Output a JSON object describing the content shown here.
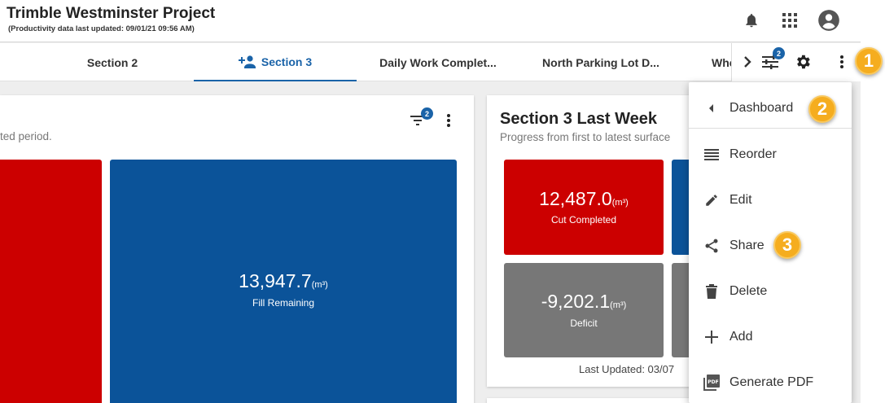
{
  "header": {
    "title": "Trimble Westminster Project",
    "subtitle": "(Productivity data last updated: 09/01/21 09:56 AM)",
    "icons": [
      "bell-icon",
      "apps-grid-icon",
      "account-icon"
    ]
  },
  "tabs": [
    {
      "label": "Section 2",
      "active": false
    },
    {
      "label": "Section 3",
      "active": true,
      "icon": "add-person-icon"
    },
    {
      "label": "Daily Work Complet...",
      "active": false
    },
    {
      "label": "North Parking Lot D...",
      "active": false
    },
    {
      "label": "Whe",
      "active": false
    }
  ],
  "tab_tools": {
    "filter_badge": "2"
  },
  "left_card": {
    "subtitle": "ted period.",
    "filter_badge": "2",
    "tile_fill": {
      "value": "13,947.7",
      "unit": "(m³)",
      "label": "Fill Remaining"
    }
  },
  "right_card": {
    "title": "Section 3 Last Week",
    "subtitle": "Progress from first to latest surface",
    "tile_cut": {
      "value": "12,487.0",
      "unit": "(m³)",
      "label": "Cut Completed"
    },
    "tile_deficit": {
      "value": "-9,202.1",
      "unit": "(m³)",
      "label": "Deficit"
    },
    "footer": "Last Updated: 03/07"
  },
  "menu": {
    "back_label": "Dashboard",
    "items": [
      {
        "label": "Reorder",
        "icon": "reorder-icon"
      },
      {
        "label": "Edit",
        "icon": "edit-pencil-icon"
      },
      {
        "label": "Share",
        "icon": "share-icon"
      },
      {
        "label": "Delete",
        "icon": "trash-icon"
      },
      {
        "label": "Add",
        "icon": "plus-icon"
      },
      {
        "label": "Generate PDF",
        "icon": "pdf-icon"
      }
    ]
  },
  "callouts": [
    "1",
    "2",
    "3"
  ],
  "colors": {
    "accent": "#1a63a8",
    "red": "#cc0000",
    "blue": "#0b5399",
    "gray": "#777777",
    "callout": "#f5ad1f"
  }
}
